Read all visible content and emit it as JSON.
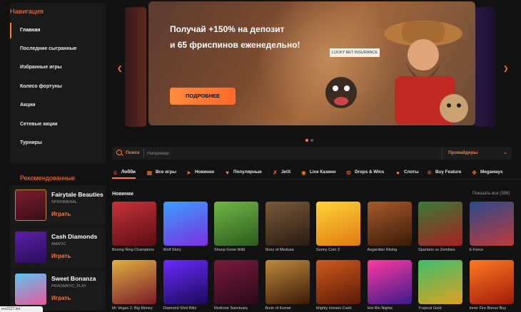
{
  "nav": {
    "title": "Навигация",
    "items": [
      "Главная",
      "Последние сыгранные",
      "Избранные игры",
      "Колесо фортуны",
      "Акции",
      "Сетевые акции",
      "Турниры"
    ]
  },
  "recommended": {
    "title": "Рекомендованные",
    "play_label": "Играть",
    "items": [
      {
        "name": "Fairytale Beauties",
        "provider": "SPINOMENAL"
      },
      {
        "name": "Cash Diamonds",
        "provider": "AMATIC"
      },
      {
        "name": "Sweet Bonanza",
        "provider": "PRAGMATIC_PLAY"
      }
    ]
  },
  "banner": {
    "line1": "Получай +150% на депозит",
    "line2": "и 65 фриспинов еженедельно!",
    "button": "ПОДРОБНЕЕ",
    "sign": "LUCKY BET INSURANCE"
  },
  "search": {
    "label": "Поиск",
    "placeholder": "Например",
    "providers": "Провайдеры"
  },
  "categories": [
    "Лобби",
    "Все игры",
    "Новинки",
    "Популярные",
    "JetX",
    "Live Казино",
    "Drops & Wins",
    "Слоты",
    "Buy Feature",
    "Megaways"
  ],
  "section": {
    "title": "Новинки",
    "show_all": "Показать все (389)"
  },
  "games_row1": [
    "Boxing Ring Champions",
    "Wolf Story",
    "Sheep Gone Wild",
    "Story of Medusa",
    "Sunny Coin 2",
    "Asgardian Rising",
    "Spartans vs Zombies",
    "E-Force"
  ],
  "games_row2": [
    "Mr Vegas 2: Big Money",
    "Diamond Shot Blitz",
    "Redrose Sanctuary",
    "Book of Kemet",
    "Mighty Horses Cash",
    "Hot Rio Nights",
    "Tropical Gold",
    "Inner Fire Bonus Buy"
  ],
  "bottom_url": "ers2227.bet"
}
